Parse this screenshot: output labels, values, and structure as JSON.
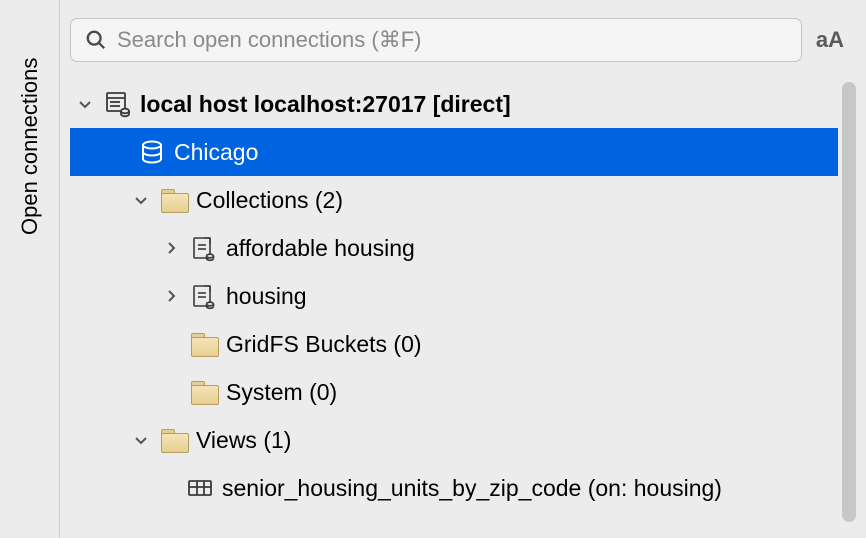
{
  "sidebar": {
    "tab_label": "Open connections"
  },
  "search": {
    "placeholder": "Search open connections (⌘F)",
    "aa_label": "aA"
  },
  "tree": {
    "connection": {
      "label": "local host localhost:27017 [direct]"
    },
    "database": {
      "label": "Chicago"
    },
    "collections": {
      "label": "Collections (2)"
    },
    "coll_items": [
      {
        "label": "affordable housing"
      },
      {
        "label": "housing"
      }
    ],
    "gridfs": {
      "label": "GridFS Buckets (0)"
    },
    "system": {
      "label": "System (0)"
    },
    "views": {
      "label": "Views (1)"
    },
    "view_items": [
      {
        "label": "senior_housing_units_by_zip_code (on: housing)"
      }
    ]
  }
}
